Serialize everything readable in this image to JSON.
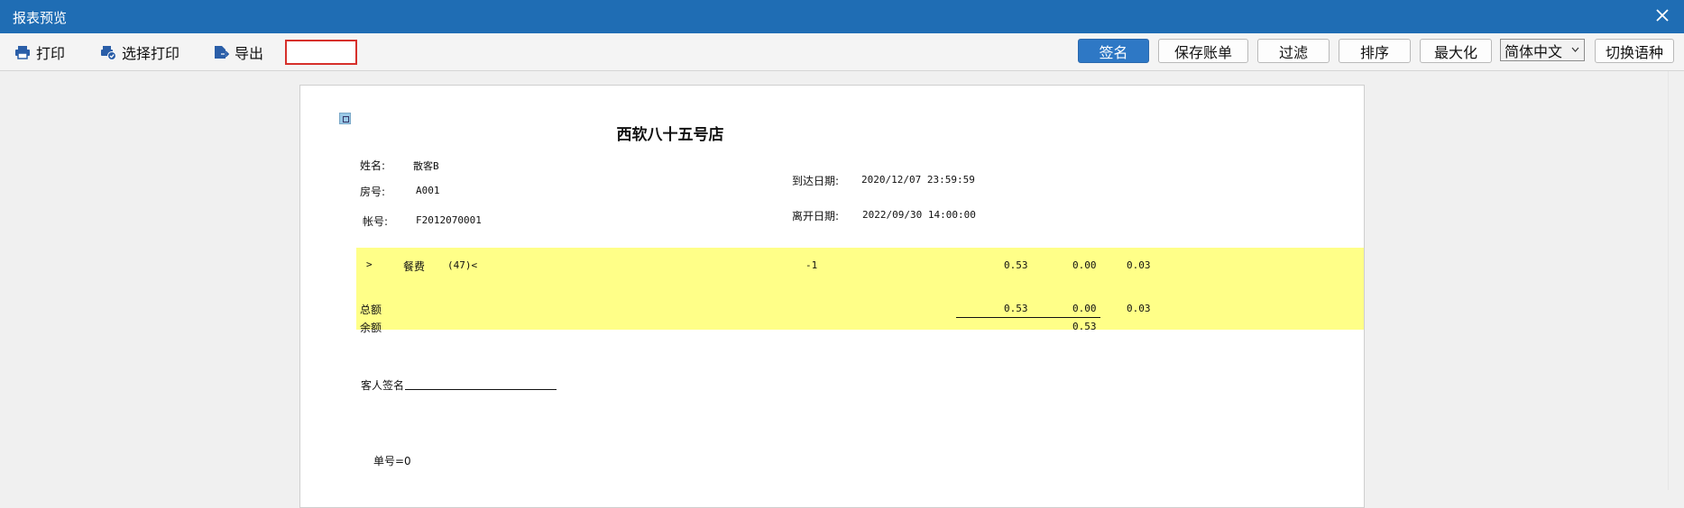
{
  "window": {
    "title": "报表预览"
  },
  "toolbar": {
    "print_label": "打印",
    "select_print_label": "选择打印",
    "export_label": "导出",
    "sign_label": "签名",
    "save_bill_label": "保存账单",
    "filter_label": "过滤",
    "sort_label": "排序",
    "maximize_label": "最大化",
    "language_value": "简体中文",
    "switch_language_label": "切换语种"
  },
  "report": {
    "hotel_name": "西软八十五号店",
    "name_label": "姓名:",
    "name_value": "散客B",
    "room_label": "房号:",
    "room_value": "A001",
    "account_label": "帐号:",
    "account_value": "F2012070001",
    "arrival_label": "到达日期:",
    "arrival_value": "2020/12/07 23:59:59",
    "departure_label": "离开日期:",
    "departure_value": "2022/09/30 14:00:00",
    "item": {
      "arrow": ">",
      "name": "餐费",
      "code": "(47)<",
      "qty": "-1",
      "amount1": "0.53",
      "amount2": "0.00",
      "amount3": "0.03"
    },
    "total_label": "总额",
    "total_amount1": "0.53",
    "total_amount2": "0.00",
    "total_amount3": "0.03",
    "balance_label": "余额",
    "balance_value": "0.53",
    "guest_sign_label": "客人签名",
    "bill_no_label": "单号=0"
  },
  "colors": {
    "titlebar": "#1f6db4",
    "primary_button": "#2e78c5",
    "highlight": "#ffff88",
    "red_box": "#d6302b"
  }
}
